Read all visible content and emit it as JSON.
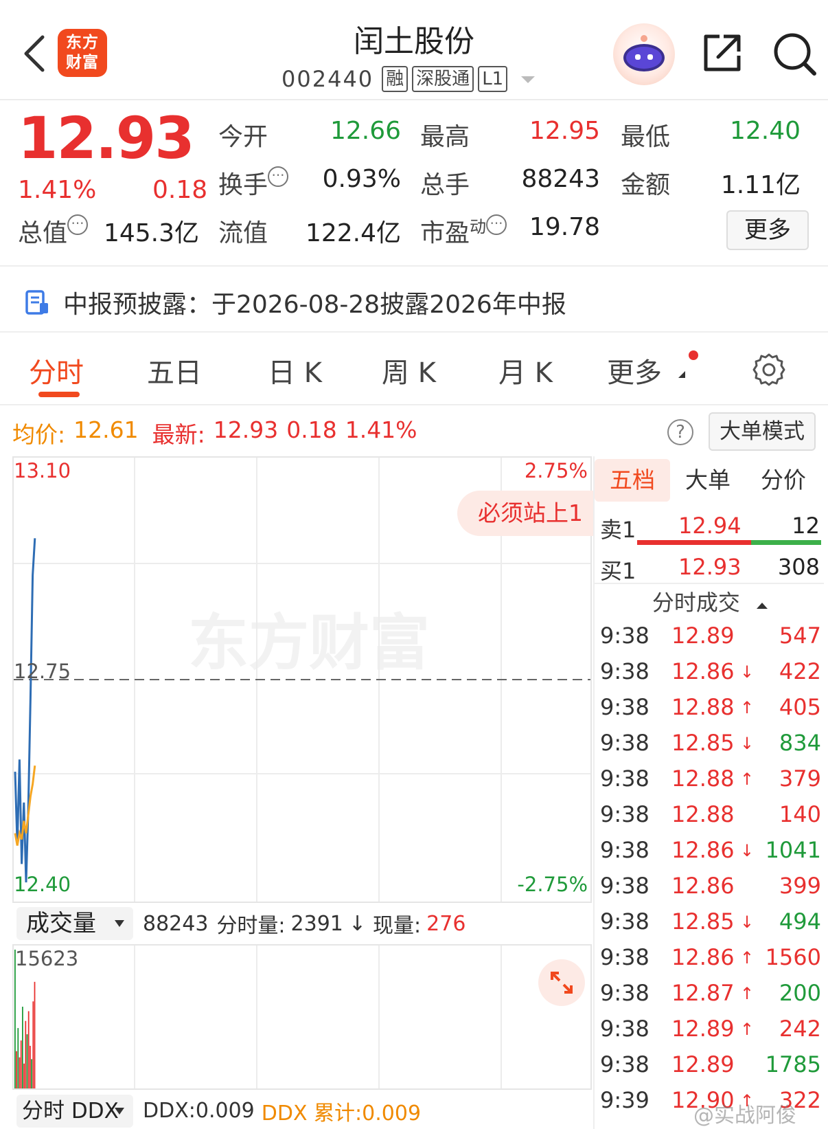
{
  "header": {
    "logo_text_line1": "东方",
    "logo_text_line2": "财富",
    "stock_name": "闰土股份",
    "stock_code": "002440",
    "tags": [
      "融",
      "深股通",
      "L1"
    ]
  },
  "quote": {
    "price": "12.93",
    "change_pct": "1.41%",
    "change": "0.18",
    "fields": [
      {
        "label": "今开",
        "value": "12.66",
        "color": "green"
      },
      {
        "label": "最高",
        "value": "12.95",
        "color": "red"
      },
      {
        "label": "最低",
        "value": "12.40",
        "color": "green"
      },
      {
        "label": "换手",
        "value": "0.93%",
        "color": "dark"
      },
      {
        "label": "总手",
        "value": "88243",
        "color": "dark"
      },
      {
        "label": "金额",
        "value": "1.11亿",
        "color": "dark"
      },
      {
        "label": "总值",
        "value": "145.3亿",
        "color": "dark"
      },
      {
        "label": "流值",
        "value": "122.4亿",
        "color": "dark"
      },
      {
        "label": "市盈",
        "sup": "动",
        "value": "19.78",
        "color": "dark"
      }
    ],
    "more_label": "更多"
  },
  "notice": {
    "text": "中报预披露：于2026-08-28披露2026年中报"
  },
  "tabs": [
    "分时",
    "五日",
    "日 K",
    "周 K",
    "月 K",
    "更多"
  ],
  "avg_bar": {
    "avg_label": "均价:",
    "avg_value": "12.61",
    "latest_label": "最新:",
    "latest_value": "12.93",
    "latest_change": "0.18",
    "latest_pct": "1.41%",
    "big_order_label": "大单模式"
  },
  "chart_data": [
    {
      "type": "line",
      "y_axis_left": {
        "max": "13.10",
        "mid": "12.75",
        "min": "12.40"
      },
      "y_axis_right": {
        "max": "2.75%",
        "min": "-2.75%"
      },
      "ylim": [
        12.4,
        13.1
      ],
      "reference_price": 12.75,
      "series": [
        {
          "color": "#2e6db4",
          "values": [
            12.6,
            12.48,
            12.62,
            12.45,
            12.55,
            12.42,
            12.54,
            12.72,
            12.92,
            12.98
          ]
        },
        {
          "color": "#f5a623",
          "values": [
            12.5,
            12.48,
            12.5,
            12.49,
            12.52,
            12.5,
            12.53,
            12.56,
            12.58,
            12.61
          ]
        }
      ],
      "watermark": "东方财富",
      "banner": "必须站上1"
    },
    {
      "type": "bar",
      "y_max_label": "15623",
      "ylim": [
        0,
        15623
      ],
      "values": [
        15623,
        4200,
        6800,
        3500,
        5400,
        9200,
        2800,
        7600,
        6100,
        8700,
        4800,
        3300,
        9800,
        12000
      ],
      "colors": [
        "green",
        "red",
        "green",
        "red",
        "red",
        "green",
        "red",
        "red",
        "green",
        "red",
        "red",
        "green",
        "red",
        "red"
      ]
    }
  ],
  "volume_toolbar": {
    "select_label": "成交量",
    "total": "88243",
    "minute_label": "分时量:",
    "minute_value": "2391",
    "current_label": "现量:",
    "current_value": "276"
  },
  "ddx_toolbar": {
    "select_label": "分时 DDX",
    "ddx_label": "DDX:",
    "ddx_value": "0.009",
    "ddx_cum": "DDX 累计:0.009"
  },
  "side_tabs": [
    "五档",
    "大单",
    "分价"
  ],
  "order_book": {
    "sell": {
      "label": "卖1",
      "price": "12.94",
      "volume": "12"
    },
    "buy": {
      "label": "买1",
      "price": "12.93",
      "volume": "308"
    },
    "sell_ratio": 0.62
  },
  "ticks_header": "分时成交",
  "ticks": [
    {
      "time": "9:38",
      "price": "12.89",
      "arrow": "",
      "vol": "547",
      "vc": "red"
    },
    {
      "time": "9:38",
      "price": "12.86",
      "arrow": "↓",
      "vol": "422",
      "vc": "red"
    },
    {
      "time": "9:38",
      "price": "12.88",
      "arrow": "↑",
      "vol": "405",
      "vc": "red"
    },
    {
      "time": "9:38",
      "price": "12.85",
      "arrow": "↓",
      "vol": "834",
      "vc": "green"
    },
    {
      "time": "9:38",
      "price": "12.88",
      "arrow": "↑",
      "vol": "379",
      "vc": "red"
    },
    {
      "time": "9:38",
      "price": "12.88",
      "arrow": "",
      "vol": "140",
      "vc": "red"
    },
    {
      "time": "9:38",
      "price": "12.86",
      "arrow": "↓",
      "vol": "1041",
      "vc": "green"
    },
    {
      "time": "9:38",
      "price": "12.86",
      "arrow": "",
      "vol": "399",
      "vc": "red"
    },
    {
      "time": "9:38",
      "price": "12.85",
      "arrow": "↓",
      "vol": "494",
      "vc": "green"
    },
    {
      "time": "9:38",
      "price": "12.86",
      "arrow": "↑",
      "vol": "1560",
      "vc": "red"
    },
    {
      "time": "9:38",
      "price": "12.87",
      "arrow": "↑",
      "vol": "200",
      "vc": "green"
    },
    {
      "time": "9:38",
      "price": "12.89",
      "arrow": "↑",
      "vol": "242",
      "vc": "red"
    },
    {
      "time": "9:38",
      "price": "12.89",
      "arrow": "",
      "vol": "1785",
      "vc": "green"
    },
    {
      "time": "9:39",
      "price": "12.90",
      "arrow": "↑",
      "vol": "322",
      "vc": "red"
    }
  ],
  "watermark_bottom": "@实战阿俊"
}
